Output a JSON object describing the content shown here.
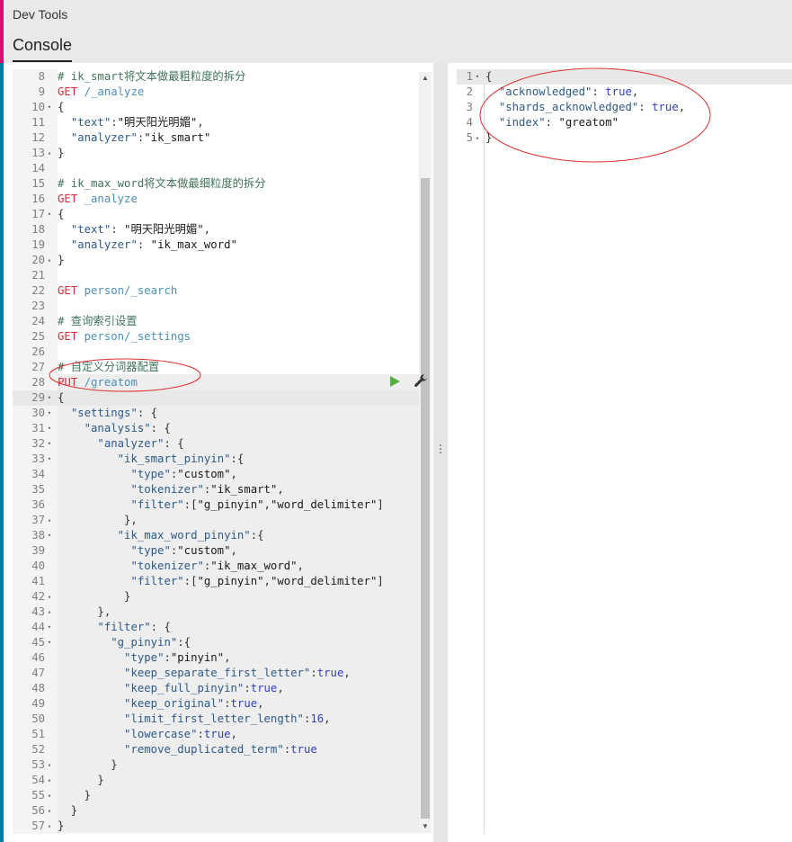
{
  "header": {
    "app_title": "Dev Tools",
    "tab_console": "Console"
  },
  "icons": {
    "run": "play-icon",
    "settings": "wrench-icon"
  },
  "colors": {
    "method": "#d9303f",
    "url": "#4a8fb8",
    "comment": "#41755c",
    "bool": "#3340c0",
    "run": "#54b33e"
  },
  "request_lines": [
    {
      "n": "8",
      "fold": "",
      "parts": [
        [
          "c",
          "# ik_smart将文本做最粗粒度的拆分"
        ]
      ]
    },
    {
      "n": "9",
      "fold": "",
      "parts": [
        [
          "m",
          "GET "
        ],
        [
          "u",
          "/_analyze"
        ]
      ]
    },
    {
      "n": "10",
      "fold": "▾",
      "parts": [
        [
          "p",
          "{"
        ]
      ]
    },
    {
      "n": "11",
      "fold": "",
      "parts": [
        [
          "p",
          "  "
        ],
        [
          "k",
          "\"text\""
        ],
        [
          "p",
          ":"
        ],
        [
          "s",
          "\"明天阳光明媚\""
        ],
        [
          "p",
          ","
        ]
      ]
    },
    {
      "n": "12",
      "fold": "",
      "parts": [
        [
          "p",
          "  "
        ],
        [
          "k",
          "\"analyzer\""
        ],
        [
          "p",
          ":"
        ],
        [
          "s",
          "\"ik_smart\""
        ]
      ]
    },
    {
      "n": "13",
      "fold": "▴",
      "parts": [
        [
          "p",
          "}"
        ]
      ]
    },
    {
      "n": "14",
      "fold": "",
      "parts": []
    },
    {
      "n": "15",
      "fold": "",
      "parts": [
        [
          "c",
          "# ik_max_word将文本做最细粒度的拆分"
        ]
      ]
    },
    {
      "n": "16",
      "fold": "",
      "parts": [
        [
          "m",
          "GET "
        ],
        [
          "u",
          "_analyze"
        ]
      ]
    },
    {
      "n": "17",
      "fold": "▾",
      "parts": [
        [
          "p",
          "{"
        ]
      ]
    },
    {
      "n": "18",
      "fold": "",
      "parts": [
        [
          "p",
          "  "
        ],
        [
          "k",
          "\"text\""
        ],
        [
          "p",
          ": "
        ],
        [
          "s",
          "\"明天阳光明媚\""
        ],
        [
          "p",
          ","
        ]
      ]
    },
    {
      "n": "19",
      "fold": "",
      "parts": [
        [
          "p",
          "  "
        ],
        [
          "k",
          "\"analyzer\""
        ],
        [
          "p",
          ": "
        ],
        [
          "s",
          "\"ik_max_word\""
        ]
      ]
    },
    {
      "n": "20",
      "fold": "▴",
      "parts": [
        [
          "p",
          "}"
        ]
      ]
    },
    {
      "n": "21",
      "fold": "",
      "parts": []
    },
    {
      "n": "22",
      "fold": "",
      "parts": [
        [
          "m",
          "GET "
        ],
        [
          "u",
          "person/_search"
        ]
      ]
    },
    {
      "n": "23",
      "fold": "",
      "parts": []
    },
    {
      "n": "24",
      "fold": "",
      "parts": [
        [
          "c",
          "# 查询索引设置"
        ]
      ]
    },
    {
      "n": "25",
      "fold": "",
      "parts": [
        [
          "m",
          "GET "
        ],
        [
          "u",
          "person/_settings"
        ]
      ]
    },
    {
      "n": "26",
      "fold": "",
      "parts": []
    },
    {
      "n": "27",
      "fold": "",
      "parts": [
        [
          "c",
          "# 自定义分词器配置"
        ]
      ]
    },
    {
      "n": "28",
      "fold": "",
      "parts": [
        [
          "m",
          "PUT "
        ],
        [
          "u",
          "/greatom"
        ]
      ]
    },
    {
      "n": "29",
      "fold": "▾",
      "parts": [
        [
          "p",
          "{"
        ]
      ]
    },
    {
      "n": "30",
      "fold": "▾",
      "parts": [
        [
          "p",
          "  "
        ],
        [
          "k",
          "\"settings\""
        ],
        [
          "p",
          ": {"
        ]
      ]
    },
    {
      "n": "31",
      "fold": "▾",
      "parts": [
        [
          "p",
          "    "
        ],
        [
          "k",
          "\"analysis\""
        ],
        [
          "p",
          ": {"
        ]
      ]
    },
    {
      "n": "32",
      "fold": "▾",
      "parts": [
        [
          "p",
          "      "
        ],
        [
          "k",
          "\"analyzer\""
        ],
        [
          "p",
          ": {"
        ]
      ]
    },
    {
      "n": "33",
      "fold": "▾",
      "parts": [
        [
          "p",
          "         "
        ],
        [
          "k",
          "\"ik_smart_pinyin\""
        ],
        [
          "p",
          ":{"
        ]
      ]
    },
    {
      "n": "34",
      "fold": "",
      "parts": [
        [
          "p",
          "           "
        ],
        [
          "k",
          "\"type\""
        ],
        [
          "p",
          ":"
        ],
        [
          "s",
          "\"custom\""
        ],
        [
          "p",
          ","
        ]
      ]
    },
    {
      "n": "35",
      "fold": "",
      "parts": [
        [
          "p",
          "           "
        ],
        [
          "k",
          "\"tokenizer\""
        ],
        [
          "p",
          ":"
        ],
        [
          "s",
          "\"ik_smart\""
        ],
        [
          "p",
          ","
        ]
      ]
    },
    {
      "n": "36",
      "fold": "",
      "parts": [
        [
          "p",
          "           "
        ],
        [
          "k",
          "\"filter\""
        ],
        [
          "p",
          ":["
        ],
        [
          "s",
          "\"g_pinyin\""
        ],
        [
          "p",
          ","
        ],
        [
          "s",
          "\"word_delimiter\""
        ],
        [
          "p",
          "]"
        ]
      ]
    },
    {
      "n": "37",
      "fold": "▴",
      "parts": [
        [
          "p",
          "          },"
        ]
      ]
    },
    {
      "n": "38",
      "fold": "▾",
      "parts": [
        [
          "p",
          "         "
        ],
        [
          "k",
          "\"ik_max_word_pinyin\""
        ],
        [
          "p",
          ":{"
        ]
      ]
    },
    {
      "n": "39",
      "fold": "",
      "parts": [
        [
          "p",
          "           "
        ],
        [
          "k",
          "\"type\""
        ],
        [
          "p",
          ":"
        ],
        [
          "s",
          "\"custom\""
        ],
        [
          "p",
          ","
        ]
      ]
    },
    {
      "n": "40",
      "fold": "",
      "parts": [
        [
          "p",
          "           "
        ],
        [
          "k",
          "\"tokenizer\""
        ],
        [
          "p",
          ":"
        ],
        [
          "s",
          "\"ik_max_word\""
        ],
        [
          "p",
          ","
        ]
      ]
    },
    {
      "n": "41",
      "fold": "",
      "parts": [
        [
          "p",
          "           "
        ],
        [
          "k",
          "\"filter\""
        ],
        [
          "p",
          ":["
        ],
        [
          "s",
          "\"g_pinyin\""
        ],
        [
          "p",
          ","
        ],
        [
          "s",
          "\"word_delimiter\""
        ],
        [
          "p",
          "]"
        ]
      ]
    },
    {
      "n": "42",
      "fold": "▴",
      "parts": [
        [
          "p",
          "          }"
        ]
      ]
    },
    {
      "n": "43",
      "fold": "▴",
      "parts": [
        [
          "p",
          "      },"
        ]
      ]
    },
    {
      "n": "44",
      "fold": "▾",
      "parts": [
        [
          "p",
          "      "
        ],
        [
          "k",
          "\"filter\""
        ],
        [
          "p",
          ": {"
        ]
      ]
    },
    {
      "n": "45",
      "fold": "▾",
      "parts": [
        [
          "p",
          "        "
        ],
        [
          "k",
          "\"g_pinyin\""
        ],
        [
          "p",
          ":{"
        ]
      ]
    },
    {
      "n": "46",
      "fold": "",
      "parts": [
        [
          "p",
          "          "
        ],
        [
          "k",
          "\"type\""
        ],
        [
          "p",
          ":"
        ],
        [
          "s",
          "\"pinyin\""
        ],
        [
          "p",
          ","
        ]
      ]
    },
    {
      "n": "47",
      "fold": "",
      "parts": [
        [
          "p",
          "          "
        ],
        [
          "k",
          "\"keep_separate_first_letter\""
        ],
        [
          "p",
          ":"
        ],
        [
          "b",
          "true"
        ],
        [
          "p",
          ","
        ]
      ]
    },
    {
      "n": "48",
      "fold": "",
      "parts": [
        [
          "p",
          "          "
        ],
        [
          "k",
          "\"keep_full_pinyin\""
        ],
        [
          "p",
          ":"
        ],
        [
          "b",
          "true"
        ],
        [
          "p",
          ","
        ]
      ]
    },
    {
      "n": "49",
      "fold": "",
      "parts": [
        [
          "p",
          "          "
        ],
        [
          "k",
          "\"keep_original\""
        ],
        [
          "p",
          ":"
        ],
        [
          "b",
          "true"
        ],
        [
          "p",
          ","
        ]
      ]
    },
    {
      "n": "50",
      "fold": "",
      "parts": [
        [
          "p",
          "          "
        ],
        [
          "k",
          "\"limit_first_letter_length\""
        ],
        [
          "p",
          ":"
        ],
        [
          "b",
          "16"
        ],
        [
          "p",
          ","
        ]
      ]
    },
    {
      "n": "51",
      "fold": "",
      "parts": [
        [
          "p",
          "          "
        ],
        [
          "k",
          "\"lowercase\""
        ],
        [
          "p",
          ":"
        ],
        [
          "b",
          "true"
        ],
        [
          "p",
          ","
        ]
      ]
    },
    {
      "n": "52",
      "fold": "",
      "parts": [
        [
          "p",
          "          "
        ],
        [
          "k",
          "\"remove_duplicated_term\""
        ],
        [
          "p",
          ":"
        ],
        [
          "b",
          "true"
        ]
      ]
    },
    {
      "n": "53",
      "fold": "▴",
      "parts": [
        [
          "p",
          "        }"
        ]
      ]
    },
    {
      "n": "54",
      "fold": "▴",
      "parts": [
        [
          "p",
          "      }"
        ]
      ]
    },
    {
      "n": "55",
      "fold": "▴",
      "parts": [
        [
          "p",
          "    }"
        ]
      ]
    },
    {
      "n": "56",
      "fold": "▴",
      "parts": [
        [
          "p",
          "  }"
        ]
      ]
    },
    {
      "n": "57",
      "fold": "▴",
      "parts": [
        [
          "p",
          "}"
        ]
      ]
    }
  ],
  "response_lines": [
    {
      "n": "1",
      "fold": "▾",
      "parts": [
        [
          "p",
          "{"
        ]
      ]
    },
    {
      "n": "2",
      "fold": "",
      "parts": [
        [
          "p",
          "  "
        ],
        [
          "k",
          "\"acknowledged\""
        ],
        [
          "p",
          ": "
        ],
        [
          "b",
          "true"
        ],
        [
          "p",
          ","
        ]
      ]
    },
    {
      "n": "3",
      "fold": "",
      "parts": [
        [
          "p",
          "  "
        ],
        [
          "k",
          "\"shards_acknowledged\""
        ],
        [
          "p",
          ": "
        ],
        [
          "b",
          "true"
        ],
        [
          "p",
          ","
        ]
      ]
    },
    {
      "n": "4",
      "fold": "",
      "parts": [
        [
          "p",
          "  "
        ],
        [
          "k",
          "\"index\""
        ],
        [
          "p",
          ": "
        ],
        [
          "s",
          "\"greatom\""
        ]
      ]
    },
    {
      "n": "5",
      "fold": "▴",
      "parts": [
        [
          "p",
          "}"
        ]
      ]
    }
  ]
}
